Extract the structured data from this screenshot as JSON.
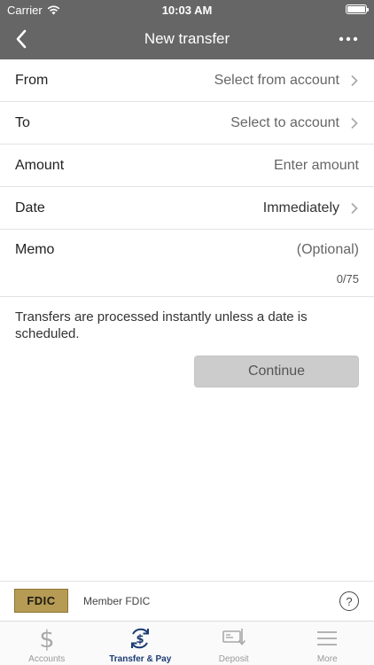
{
  "status_bar": {
    "carrier": "Carrier",
    "time": "10:03 AM"
  },
  "navbar": {
    "title": "New transfer"
  },
  "form": {
    "from": {
      "label": "From",
      "value": "Select from account"
    },
    "to": {
      "label": "To",
      "value": "Select to account"
    },
    "amount": {
      "label": "Amount",
      "placeholder": "Enter amount"
    },
    "date": {
      "label": "Date",
      "value": "Immediately"
    },
    "memo": {
      "label": "Memo",
      "placeholder": "(Optional)",
      "counter": "0/75"
    }
  },
  "info_text": "Transfers are processed instantly unless a date is scheduled.",
  "continue_label": "Continue",
  "fdic": {
    "logo_text": "FDIC",
    "text": "Member FDIC",
    "help": "?"
  },
  "tabs": [
    {
      "label": "Accounts",
      "icon": "dollar-icon"
    },
    {
      "label": "Transfer & Pay",
      "icon": "transfer-pay-icon",
      "active": true
    },
    {
      "label": "Deposit",
      "icon": "check-deposit-icon"
    },
    {
      "label": "More",
      "icon": "menu-icon"
    }
  ],
  "colors": {
    "header": "#666666",
    "active_tab": "#1b3b73",
    "button": "#cccccc",
    "fdic_gold": "#b59b54"
  }
}
